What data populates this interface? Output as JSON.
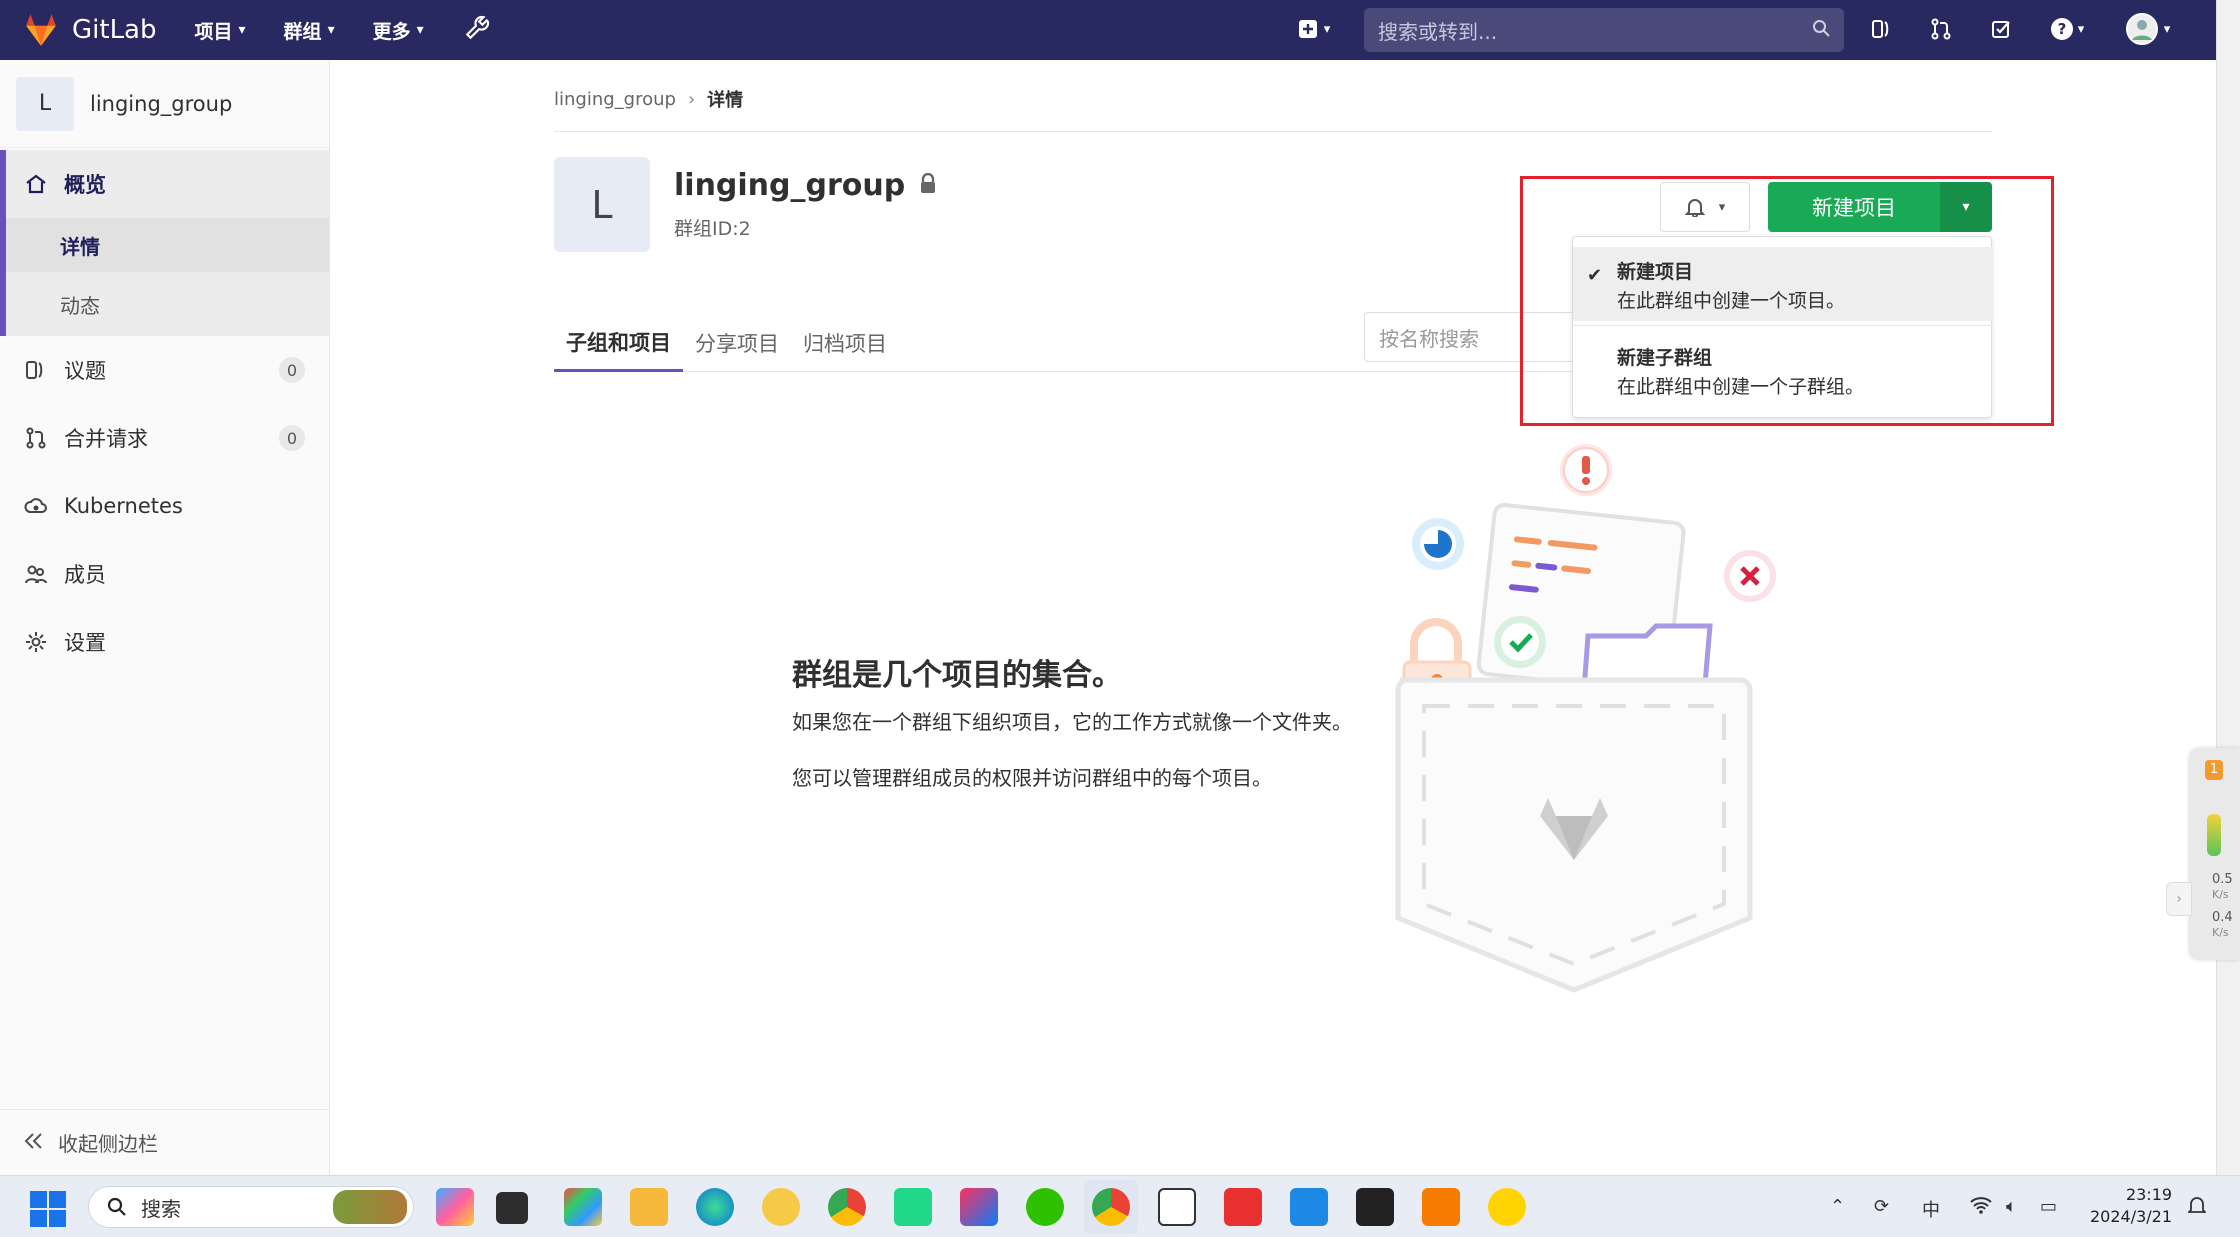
{
  "topbar": {
    "brand": "GitLab",
    "nav": [
      "项目",
      "群组",
      "更多"
    ],
    "search_placeholder": "搜索或转到..."
  },
  "sidebar": {
    "group_initial": "L",
    "group_name": "linging_group",
    "overview": "概览",
    "sub_items": [
      "详情",
      "动态"
    ],
    "items": [
      {
        "label": "议题",
        "badge": "0"
      },
      {
        "label": "合并请求",
        "badge": "0"
      },
      {
        "label": "Kubernetes"
      },
      {
        "label": "成员"
      },
      {
        "label": "设置"
      }
    ],
    "collapse": "收起侧边栏"
  },
  "breadcrumb": {
    "root": "linging_group",
    "current": "详情"
  },
  "group": {
    "initial": "L",
    "name": "linging_group",
    "id_text": "群组ID:2"
  },
  "actions": {
    "new_project": "新建项目"
  },
  "tabs": [
    "子组和项目",
    "分享项目",
    "归档项目"
  ],
  "filter_placeholder": "按名称搜索",
  "dropdown": {
    "items": [
      {
        "title": "新建项目",
        "desc": "在此群组中创建一个项目。",
        "selected": true
      },
      {
        "title": "新建子群组",
        "desc": "在此群组中创建一个子群组。",
        "selected": false
      }
    ]
  },
  "empty_state": {
    "title": "群组是几个项目的集合。",
    "p1": "如果您在一个群组下组织项目，它的工作方式就像一个文件夹。",
    "p2": "您可以管理群组成员的权限并访问群组中的每个项目。"
  },
  "float_widget": {
    "badge": "1",
    "up": "0.5",
    "down": "0.4",
    "unit": "K/s"
  },
  "taskbar": {
    "search": "搜索",
    "ime": "中",
    "time": "23:19",
    "date": "2024/3/21"
  },
  "colors": {
    "topbar": "#292961",
    "accent": "#6b4fbb",
    "primary_button": "#1aaa55",
    "annotation": "#e3202b"
  }
}
